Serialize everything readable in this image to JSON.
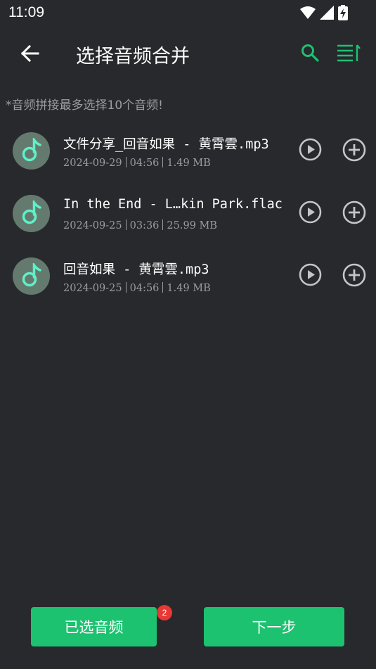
{
  "status_bar": {
    "time": "11:09",
    "icons": [
      "wifi-icon",
      "signal-icon",
      "battery-charging-icon"
    ]
  },
  "header": {
    "back_icon": "arrow-left-icon",
    "title": "选择音频合并",
    "search_icon": "search-icon",
    "sort_icon": "sort-list-icon",
    "accent_color": "#1cc270"
  },
  "hint": "*音频拼接最多选择10个音频!",
  "files": [
    {
      "name": "文件分享_回音如果 - 黄霄雲.mp3",
      "date": "2024-09-29",
      "duration": "04:56",
      "size": "1.49 MB",
      "thumb_icon": "music-note-icon",
      "play_icon": "play-circle-icon",
      "add_icon": "add-circle-icon"
    },
    {
      "name": "In the End - L…kin Park.flac",
      "date": "2024-09-25",
      "duration": "03:36",
      "size": "25.99 MB",
      "thumb_icon": "music-note-icon",
      "play_icon": "play-circle-icon",
      "add_icon": "add-circle-icon"
    },
    {
      "name": "回音如果 - 黄霄雲.mp3",
      "date": "2024-09-25",
      "duration": "04:56",
      "size": "1.49 MB",
      "thumb_icon": "music-note-icon",
      "play_icon": "play-circle-icon",
      "add_icon": "add-circle-icon"
    }
  ],
  "bottom_bar": {
    "selected_label": "已选音频",
    "selected_count": "2",
    "next_label": "下一步",
    "button_color": "#1cc270",
    "badge_color": "#e53935"
  }
}
